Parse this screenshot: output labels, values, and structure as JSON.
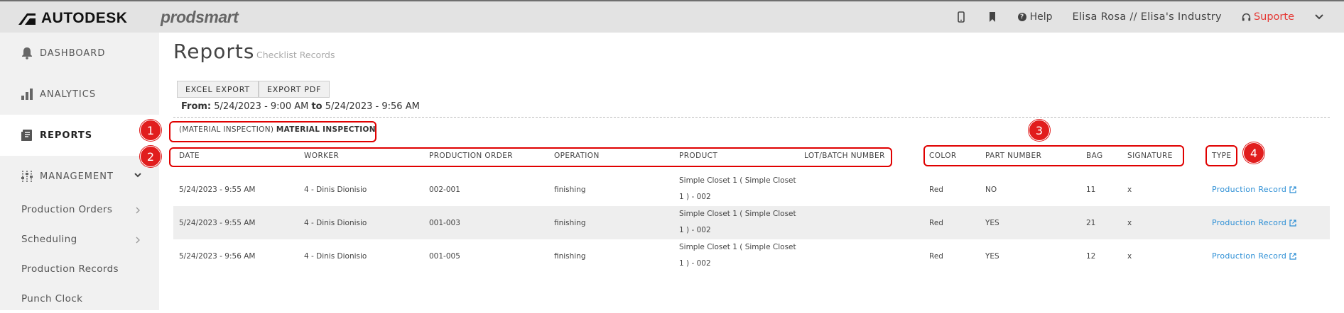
{
  "brand": {
    "name": "AUTODESK",
    "product": "prodsmart"
  },
  "topbar": {
    "help_label": "Help",
    "user_label": "Elisa Rosa // Elisa's Industry",
    "support_label": "Suporte",
    "icons": [
      "mobile-icon",
      "bookmark-icon",
      "help-icon",
      "headset-icon",
      "chevron-down-icon"
    ]
  },
  "sidebar": {
    "main_items": [
      {
        "label": "DASHBOARD",
        "icon": "bell-icon"
      },
      {
        "label": "ANALYTICS",
        "icon": "bar-chart-icon"
      },
      {
        "label": "REPORTS",
        "icon": "report-icon",
        "active": true
      },
      {
        "label": "MANAGEMENT",
        "icon": "sliders-icon"
      }
    ],
    "sub_items": [
      {
        "label": "Production Orders"
      },
      {
        "label": "Scheduling"
      },
      {
        "label": "Production Records"
      },
      {
        "label": "Punch Clock"
      }
    ]
  },
  "page": {
    "title": "Reports",
    "subtitle": "Checklist Records",
    "excel_button": "EXCEL EXPORT",
    "pdf_button": "EXPORT PDF",
    "from_label": "From:",
    "from_value": "5/24/2023 - 9:00 AM",
    "to_label": "to",
    "to_value": "5/24/2023 - 9:56 AM"
  },
  "section": {
    "prefix": "(MATERIAL INSPECTION)",
    "name": "MATERIAL INSPECTION"
  },
  "table": {
    "headers": {
      "date": "DATE",
      "worker": "WORKER",
      "production_order": "PRODUCTION ORDER",
      "operation": "OPERATION",
      "product": "PRODUCT",
      "lot": "LOT/BATCH NUMBER",
      "color": "COLOR",
      "part_number": "PART NUMBER",
      "bag": "BAG",
      "signature": "SIGNATURE",
      "type": "TYPE"
    },
    "rows": [
      {
        "date": "5/24/2023 - 9:55 AM",
        "worker": "4 - Dinis Dionisio",
        "order": "002-001",
        "operation": "finishing",
        "product_line1": "Simple Closet 1 ( Simple Closet",
        "product_line2": "1 ) - 002",
        "color": "Red",
        "part_number": "NO",
        "bag": "11",
        "signature": "x",
        "type": "Production Record"
      },
      {
        "date": "5/24/2023 - 9:55 AM",
        "worker": "4 - Dinis Dionisio",
        "order": "001-003",
        "operation": "finishing",
        "product_line1": "Simple Closet 1 ( Simple Closet",
        "product_line2": "1 ) - 002",
        "color": "Red",
        "part_number": "YES",
        "bag": "21",
        "signature": "x",
        "type": "Production Record"
      },
      {
        "date": "5/24/2023 - 9:56 AM",
        "worker": "4 - Dinis Dionisio",
        "order": "001-005",
        "operation": "finishing",
        "product_line1": "Simple Closet 1 ( Simple Closet",
        "product_line2": "1 ) - 002",
        "color": "Red",
        "part_number": "YES",
        "bag": "12",
        "signature": "x",
        "type": "Production Record"
      }
    ]
  },
  "annotations": [
    "1",
    "2",
    "3",
    "4"
  ],
  "colors": {
    "accent_red": "#e53935",
    "link_blue": "#2d8fd5",
    "annotation_red": "#e11d1d"
  }
}
